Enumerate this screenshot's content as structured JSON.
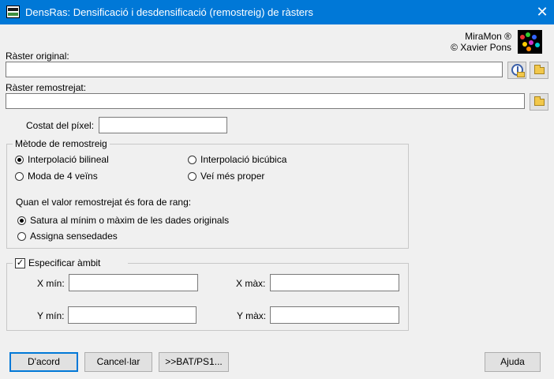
{
  "window": {
    "title": "DensRas: Densificació i desdensificació (remostreig) de ràsters",
    "close_label": "✕"
  },
  "brand": {
    "line1": "MiraMon ®",
    "line2": "© Xavier Pons"
  },
  "raster_original": {
    "label": "Ràster original:",
    "value": ""
  },
  "raster_remostrejat": {
    "label": "Ràster remostrejat:",
    "value": ""
  },
  "costat": {
    "label": "Costat del píxel:",
    "value": ""
  },
  "metode": {
    "legend": "Mètode de remostreig",
    "options": [
      {
        "label": "Interpolació bilineal",
        "checked": true
      },
      {
        "label": "Interpolació bicúbica",
        "checked": false
      },
      {
        "label": "Moda de 4 veïns",
        "checked": false
      },
      {
        "label": "Veí més proper",
        "checked": false
      }
    ],
    "out_of_range_label": "Quan el valor remostrejat és fora de rang:",
    "out_options": [
      {
        "label": "Satura al mínim o màxim de les dades originals",
        "checked": true
      },
      {
        "label": "Assigna sensedades",
        "checked": false
      }
    ]
  },
  "ambit": {
    "label": "Especificar àmbit",
    "checked": true,
    "check_mark": "✓",
    "xmin": {
      "label": "X mín:",
      "value": ""
    },
    "xmax": {
      "label": "X màx:",
      "value": ""
    },
    "ymin": {
      "label": "Y mín:",
      "value": ""
    },
    "ymax": {
      "label": "Y màx:",
      "value": ""
    }
  },
  "buttons": {
    "ok": "D'acord",
    "cancel": "Cancel·lar",
    "bat": ">>BAT/PS1...",
    "help": "Ajuda"
  },
  "icons": {
    "app": "densras-app-icon",
    "logo": "miramon-logo",
    "globe": "globe-folder-icon",
    "folder": "folder-icon"
  }
}
